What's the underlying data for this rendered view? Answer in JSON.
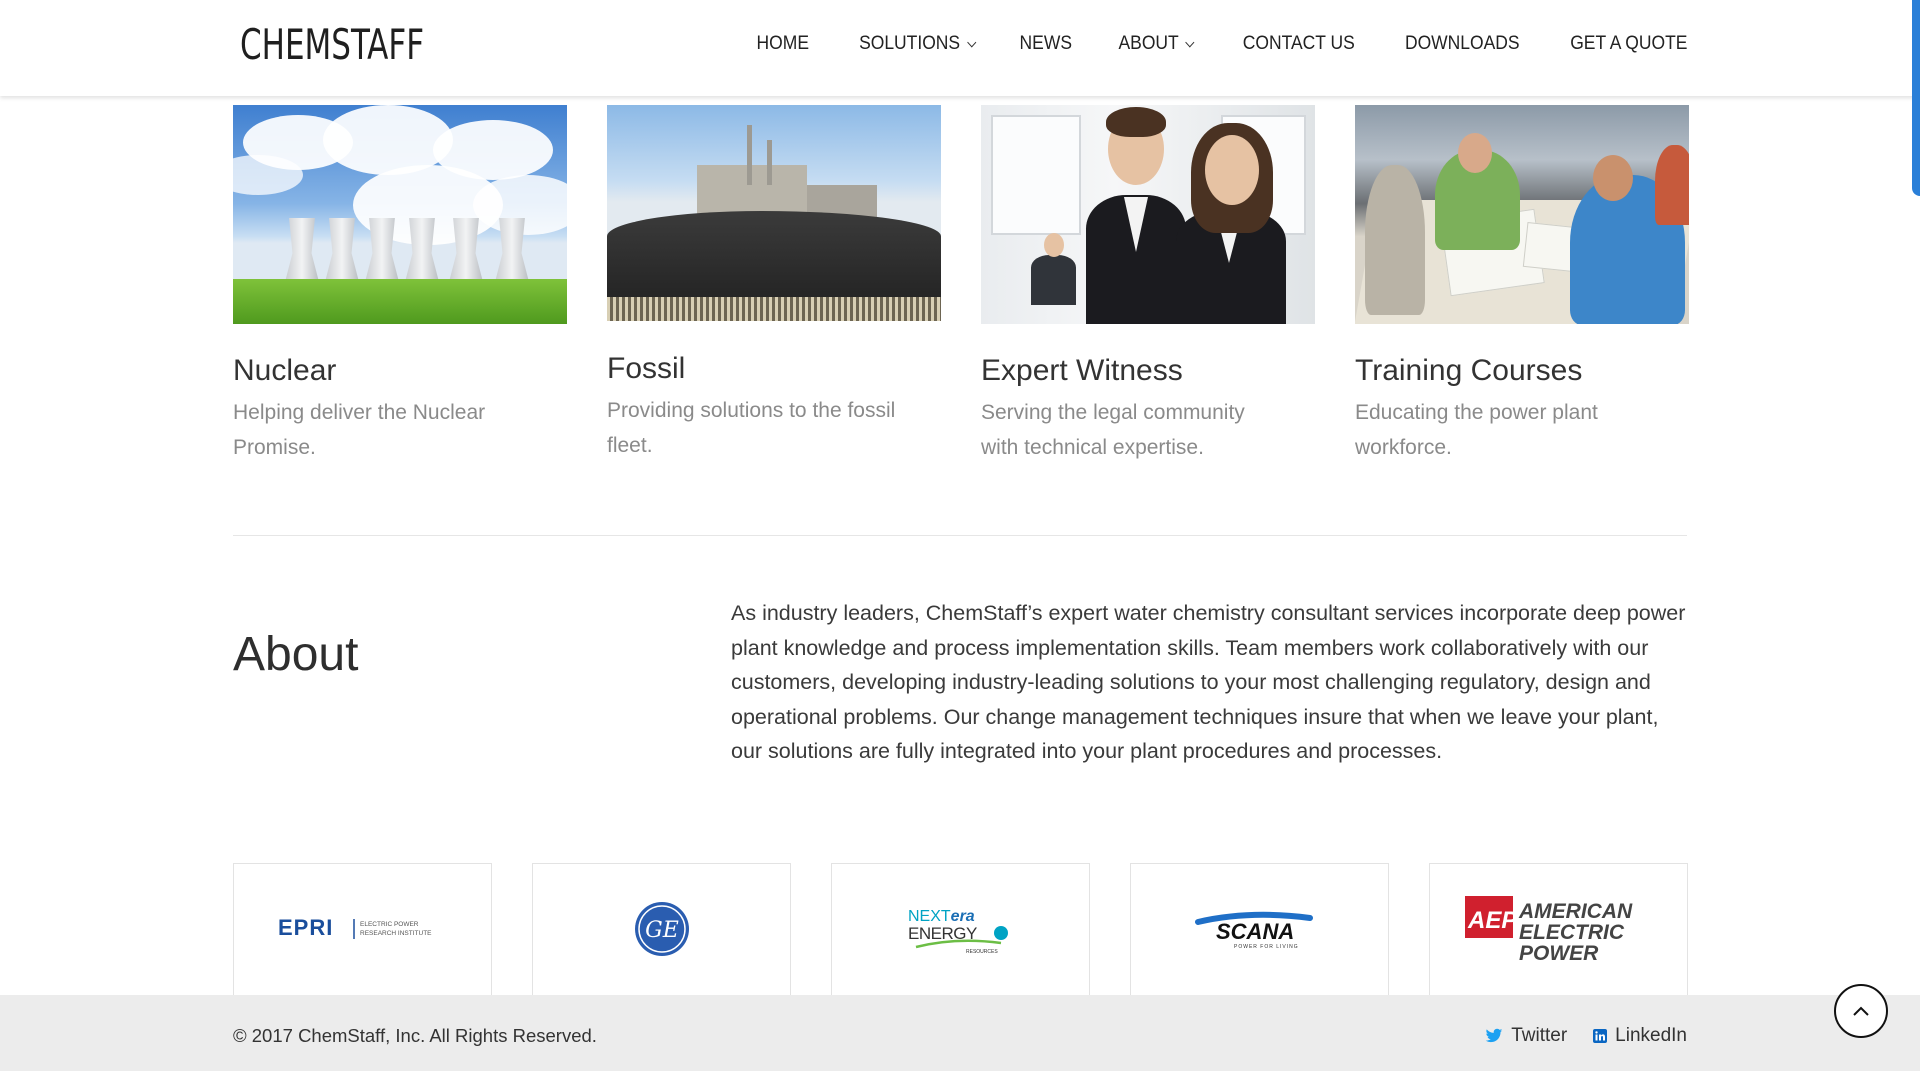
{
  "header": {
    "logo": "CHEMSTAFF",
    "nav": [
      {
        "label": "HOME",
        "dropdown": false
      },
      {
        "label": "SOLUTIONS",
        "dropdown": true
      },
      {
        "label": "NEWS",
        "dropdown": false
      },
      {
        "label": "ABOUT",
        "dropdown": true
      },
      {
        "label": "CONTACT US",
        "dropdown": false
      },
      {
        "label": "DOWNLOADS",
        "dropdown": false
      },
      {
        "label": "GET A QUOTE",
        "dropdown": false
      }
    ]
  },
  "solutions": [
    {
      "title": "Nuclear",
      "description": "Helping deliver the Nuclear Promise."
    },
    {
      "title": "Fossil",
      "description": "Providing solutions to the fossil fleet."
    },
    {
      "title": "Expert Witness",
      "description": "Serving the legal community with technical expertise."
    },
    {
      "title": "Training Courses",
      "description": "Educating the power plant workforce."
    }
  ],
  "about": {
    "title": "About",
    "text": "As industry leaders, ChemStaff’s  expert  water chemistry consultant services incorporate deep power plant knowledge and process implementation skills. Team members work collaboratively with our customers, developing industry-leading solutions to your most challenging regulatory, design and operational problems. Our change management techniques insure that when we leave your plant, our solutions are fully integrated into your plant procedures and processes."
  },
  "partners": [
    {
      "name": "EPRI",
      "logo_text": "EPRI",
      "sub_text": "ELECTRIC POWER RESEARCH INSTITUTE"
    },
    {
      "name": "GE",
      "logo_text": "GE"
    },
    {
      "name": "NextEra Energy",
      "logo_text": "NEXTera ENERGY",
      "sub_text": "RESOURCES"
    },
    {
      "name": "SCANA",
      "logo_text": "SCANA",
      "sub_text": "POWER FOR LIVING"
    },
    {
      "name": "AEP",
      "logo_text": "AEP",
      "sub_text": "AMERICAN ELECTRIC POWER"
    }
  ],
  "footer": {
    "copyright": "© 2017 ChemStaff, Inc. All Rights Reserved.",
    "social": [
      {
        "label": "Twitter",
        "icon": "twitter-icon"
      },
      {
        "label": "LinkedIn",
        "icon": "linkedin-icon"
      }
    ]
  },
  "colors": {
    "accent": "#2a7fd8",
    "footer_bg": "#ececec",
    "twitter": "#1da1f2",
    "linkedin": "#0a66c2",
    "epri": "#1a4e9c",
    "ge": "#2a5db0",
    "nextera": "#00a3c4",
    "aep": "#d0202e"
  }
}
